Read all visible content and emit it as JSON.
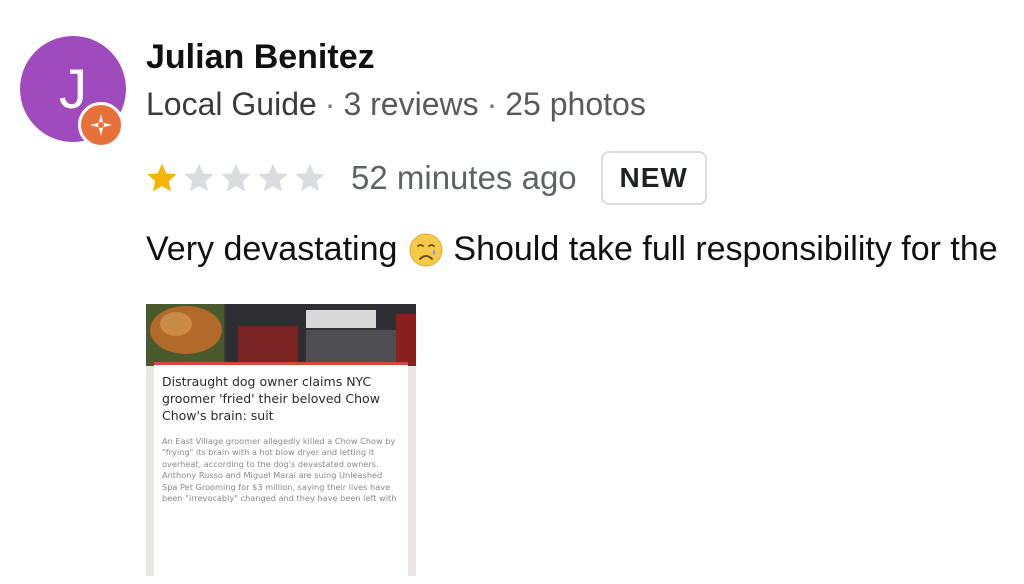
{
  "reviewer": {
    "initial": "J",
    "name": "Julian Benitez",
    "role": "Local Guide",
    "separator": "·",
    "reviews": "3 reviews",
    "photos": "25 photos"
  },
  "rating": {
    "stars": 1,
    "max_stars": 5,
    "filled_color": "#f4b400",
    "empty_color": "#dadce0"
  },
  "time_ago": "52 minutes ago",
  "badge": "NEW",
  "review": {
    "text_before_emoji": "Very devastating",
    "emoji": "crying-face-icon",
    "text_after_emoji": "Should take full responsibility for the"
  },
  "photo": {
    "headline": "Distraught dog owner claims NYC groomer 'fried' their beloved Chow Chow's brain: suit",
    "body": "An East Village groomer allegedly killed a Chow Chow by \"frying\" its brain with a hot blow dryer and letting it overheat, according to the dog's devastated owners. Anthony Russo and Miguel Marai are suing Unleashed Spa Pet Grooming for $3 million, saying their lives have been \"irrevocably\" changed and they have been left with"
  },
  "colors": {
    "avatar": "#a04bbd",
    "local_guide_badge": "#e8703a",
    "article_accent": "#d4483d"
  }
}
